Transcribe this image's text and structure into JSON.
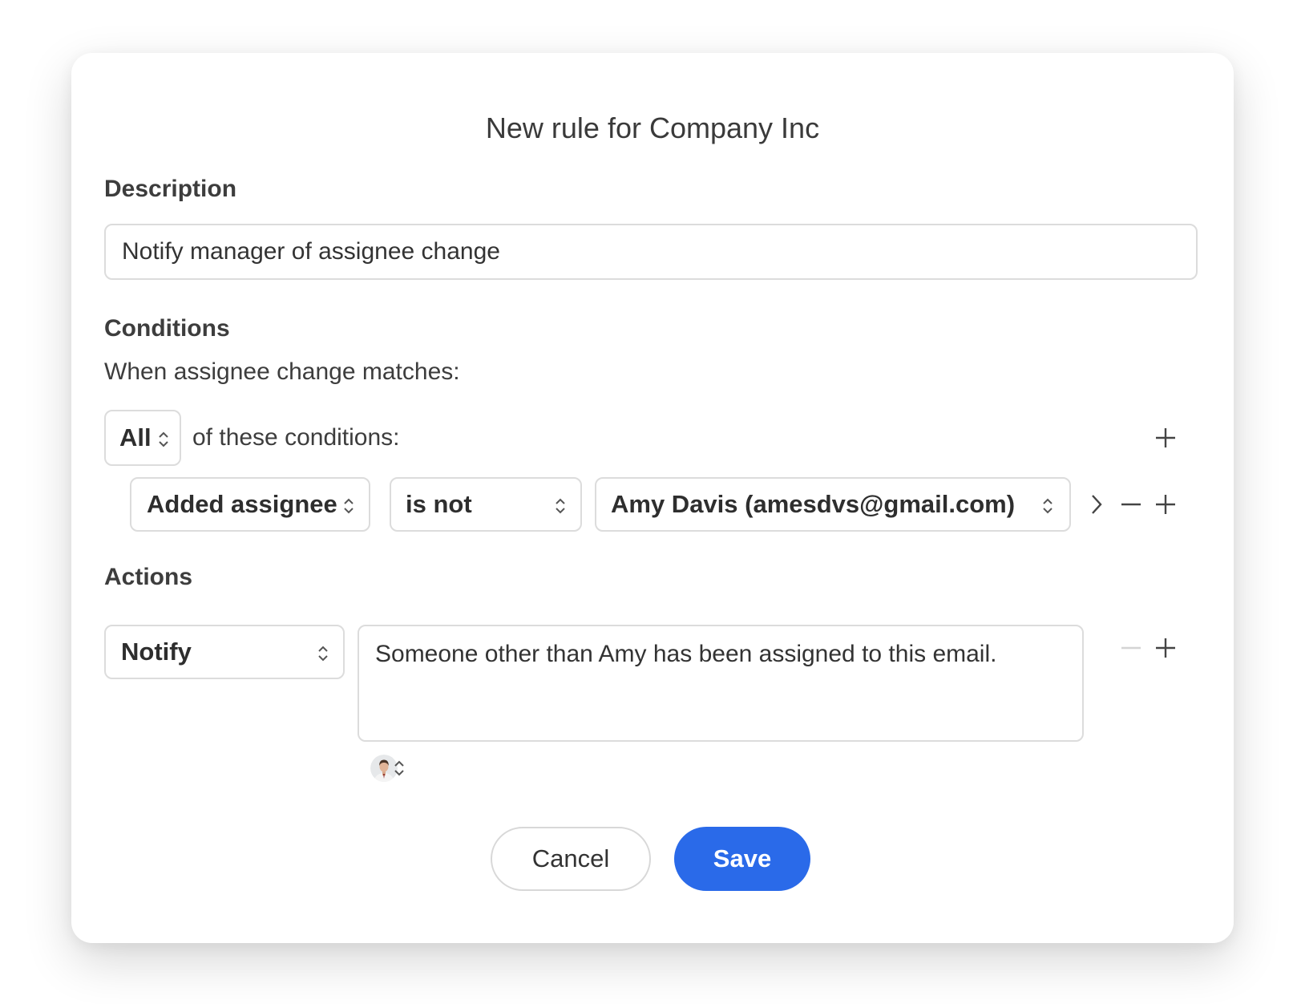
{
  "dialog": {
    "title": "New rule for Company Inc"
  },
  "description": {
    "label": "Description",
    "value": "Notify manager of assignee change"
  },
  "conditions": {
    "label": "Conditions",
    "intro": "When assignee change matches:",
    "match_mode": "All",
    "match_suffix": "of these conditions:",
    "rule": {
      "field": "Added assignee",
      "operator": "is not",
      "value": "Amy Davis (amesdvs@gmail.com)"
    }
  },
  "actions": {
    "label": "Actions",
    "type": "Notify",
    "message": "Someone other than Amy has been assigned to this email."
  },
  "buttons": {
    "cancel": "Cancel",
    "save": "Save"
  },
  "colors": {
    "primary": "#2a6ae9",
    "border": "#dcdcdc",
    "text": "#333333"
  },
  "icons": {
    "updown": "chevron-updown-icon",
    "chevron_right": "chevron-right-icon",
    "minus": "minus-icon",
    "plus": "plus-icon"
  }
}
